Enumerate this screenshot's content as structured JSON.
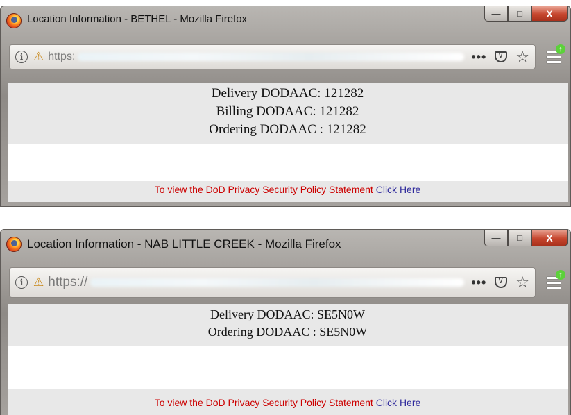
{
  "windows": [
    {
      "title": "Location Information - BETHEL - Mozilla Firefox",
      "url": "https:",
      "fields": [
        "Delivery DODAAC: 121282",
        "Billing DODAAC: 121282",
        "Ordering DODAAC : 121282"
      ],
      "footer_text": "To view the DoD Privacy Security Policy Statement ",
      "footer_link": "Click Here"
    },
    {
      "title": "Location Information - NAB LITTLE CREEK - Mozilla Firefox",
      "url": "https://",
      "fields": [
        "Delivery DODAAC: SE5N0W",
        "Ordering DODAAC : SE5N0W"
      ],
      "footer_text": "To view the DoD Privacy Security Policy Statement ",
      "footer_link": "Click Here"
    }
  ],
  "controls": {
    "minimize": "—",
    "maximize": "□",
    "close": "X",
    "page_actions": "•••",
    "bookmark": "☆",
    "update_badge": "↑"
  },
  "icons": [
    "firefox-logo-icon",
    "info-icon",
    "lock-warning-icon",
    "pocket-icon",
    "star-icon",
    "hamburger-menu-icon"
  ],
  "colors": {
    "footer_text": "#cc0000",
    "link": "#2f2a9c",
    "content_bg": "#e8e8e8"
  }
}
